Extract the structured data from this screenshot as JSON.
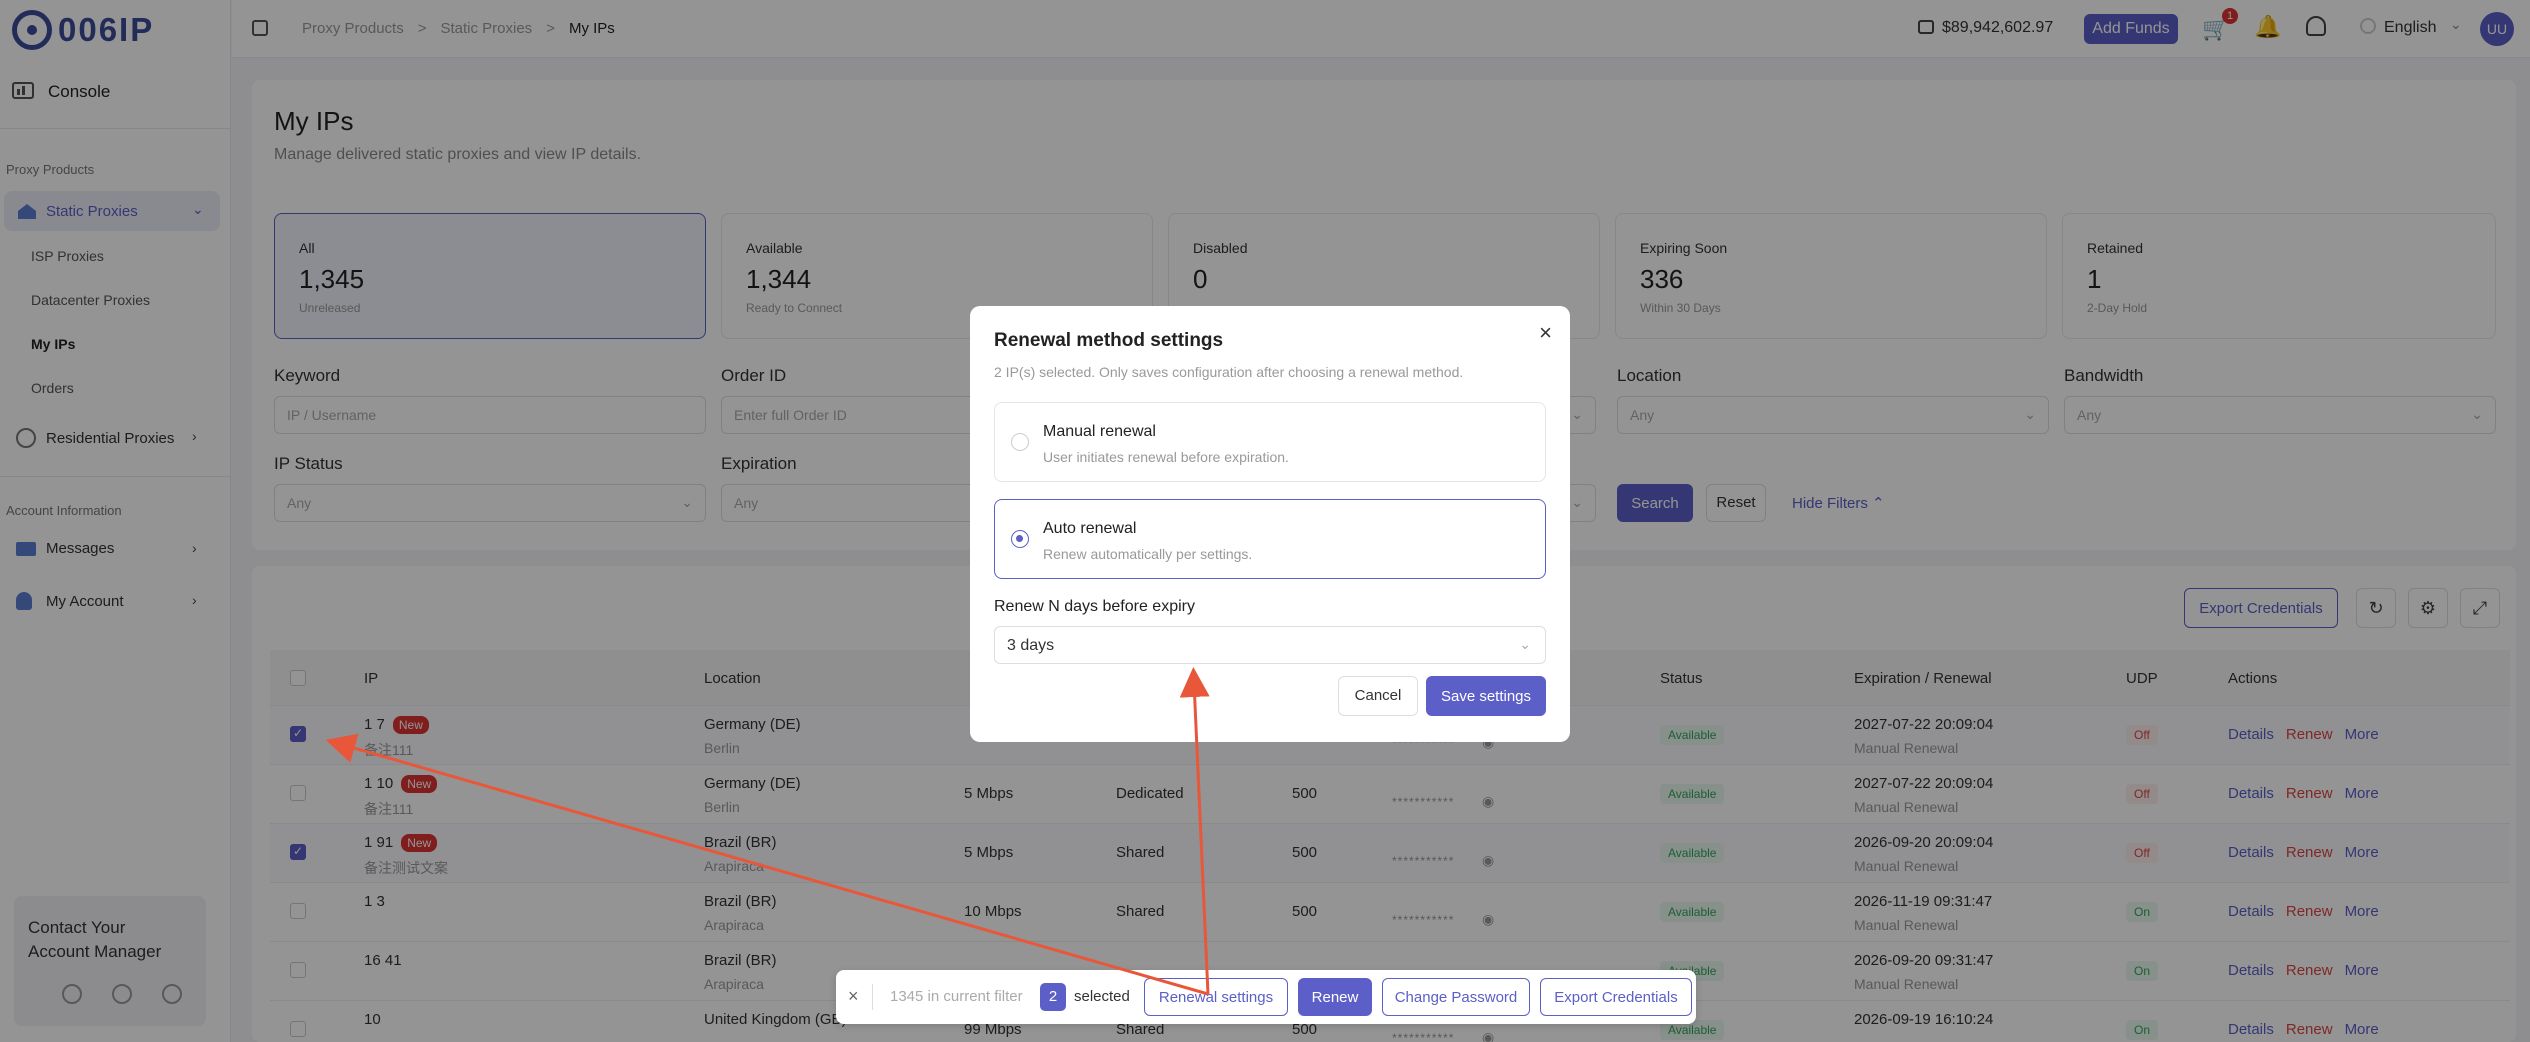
{
  "brand": {
    "logo_text": "006IP"
  },
  "sidebar": {
    "console": "Console",
    "section_proxy": "Proxy Products",
    "static_proxies": "Static Proxies",
    "sub_items": [
      "ISP Proxies",
      "Datacenter Proxies",
      "My IPs",
      "Orders"
    ],
    "residential": "Residential Proxies",
    "section_account": "Account Information",
    "messages": "Messages",
    "my_account": "My Account",
    "contact_line1": "Contact Your",
    "contact_line2": "Account Manager"
  },
  "topbar": {
    "breadcrumbs": [
      "Proxy Products",
      "Static Proxies",
      "My IPs"
    ],
    "separator": ">",
    "balance": "$89,942,602.97",
    "add_funds": "Add Funds",
    "cart_count": "1",
    "language": "English",
    "avatar": "UU"
  },
  "page": {
    "title": "My IPs",
    "subtitle": "Manage delivered static proxies and view IP details."
  },
  "stats": [
    {
      "label": "All",
      "value": "1,345",
      "sub": "Unreleased"
    },
    {
      "label": "Available",
      "value": "1,344",
      "sub": "Ready to Connect"
    },
    {
      "label": "Disabled",
      "value": "0",
      "sub": ""
    },
    {
      "label": "Expiring Soon",
      "value": "336",
      "sub": "Within 30 Days"
    },
    {
      "label": "Retained",
      "value": "1",
      "sub": "2-Day Hold"
    }
  ],
  "filters": {
    "keyword_label": "Keyword",
    "keyword_ph": "IP / Username",
    "order_label": "Order ID",
    "order_ph": "Enter full Order ID",
    "location_label": "Location",
    "location_value": "Any",
    "bandwidth_label": "Bandwidth",
    "bandwidth_value": "Any",
    "ipstatus_label": "IP Status",
    "ipstatus_value": "Any",
    "expiration_label": "Expiration",
    "expiration_value": "Any",
    "search": "Search",
    "reset": "Reset",
    "hide_filters": "Hide Filters"
  },
  "table": {
    "export": "Export Credentials",
    "headers": [
      "IP",
      "Location",
      "Status",
      "Expiration / Renewal",
      "UDP",
      "Actions"
    ],
    "new_badge": "New",
    "masked": "***********",
    "actions": [
      "Details",
      "Renew",
      "More"
    ],
    "rows": [
      {
        "ip": "1            7",
        "note": "备注111",
        "new": "New",
        "loc": "Germany (DE)",
        "city": "Berlin",
        "bw": "",
        "type": "",
        "num": "",
        "status": "Available",
        "exp": "2027-07-22 20:09:04",
        "ren": "Manual Renewal",
        "udp": "Off",
        "checked": true
      },
      {
        "ip": "1            10",
        "note": "备注111",
        "new": "New",
        "loc": "Germany (DE)",
        "city": "Berlin",
        "bw": "5 Mbps",
        "type": "Dedicated",
        "num": "500",
        "status": "Available",
        "exp": "2027-07-22 20:09:04",
        "ren": "Manual Renewal",
        "udp": "Off",
        "checked": false
      },
      {
        "ip": "1            91",
        "note": "备注测试文案",
        "new": "New",
        "loc": "Brazil (BR)",
        "city": "Arapiraca",
        "bw": "5 Mbps",
        "type": "Shared",
        "num": "500",
        "status": "Available",
        "exp": "2026-09-20 20:09:04",
        "ren": "Manual Renewal",
        "udp": "Off",
        "checked": true
      },
      {
        "ip": "1            3",
        "note": "",
        "new": "",
        "loc": "Brazil (BR)",
        "city": "Arapiraca",
        "bw": "10 Mbps",
        "type": "Shared",
        "num": "500",
        "status": "Available",
        "exp": "2026-11-19 09:31:47",
        "ren": "Manual Renewal",
        "udp": "On",
        "checked": false
      },
      {
        "ip": "16           41",
        "note": "",
        "new": "",
        "loc": "Brazil (BR)",
        "city": "Arapiraca",
        "bw": "",
        "type": "",
        "num": "",
        "status": "Available",
        "exp": "2026-09-20 09:31:47",
        "ren": "Manual Renewal",
        "udp": "On",
        "checked": false
      },
      {
        "ip": "10",
        "note": "",
        "new": "",
        "loc": "United Kingdom (GB)",
        "city": "",
        "bw": "99 Mbps",
        "type": "Shared",
        "num": "500",
        "status": "Available",
        "exp": "2026-09-19 16:10:24",
        "ren": "",
        "udp": "On",
        "checked": false
      }
    ]
  },
  "modal": {
    "title": "Renewal method settings",
    "subtitle": "2 IP(s) selected. Only saves configuration after choosing a renewal method.",
    "close": "×",
    "manual_title": "Manual renewal",
    "manual_desc": "User initiates renewal before expiration.",
    "auto_title": "Auto renewal",
    "auto_desc": "Renew automatically per settings.",
    "days_label": "Renew N days before expiry",
    "days_value": "3 days",
    "cancel": "Cancel",
    "save": "Save settings"
  },
  "bottom_bar": {
    "close": "×",
    "filter_text": "1345 in current filter",
    "selected_count": "2",
    "selected_text": "selected",
    "renewal_settings": "Renewal settings",
    "renew": "Renew",
    "change_password": "Change Password",
    "export": "Export Credentials"
  },
  "colors": {
    "accent": "#5b5fc7",
    "danger": "#d44444",
    "success": "#2fa65a",
    "annotation": "#e8573a"
  }
}
